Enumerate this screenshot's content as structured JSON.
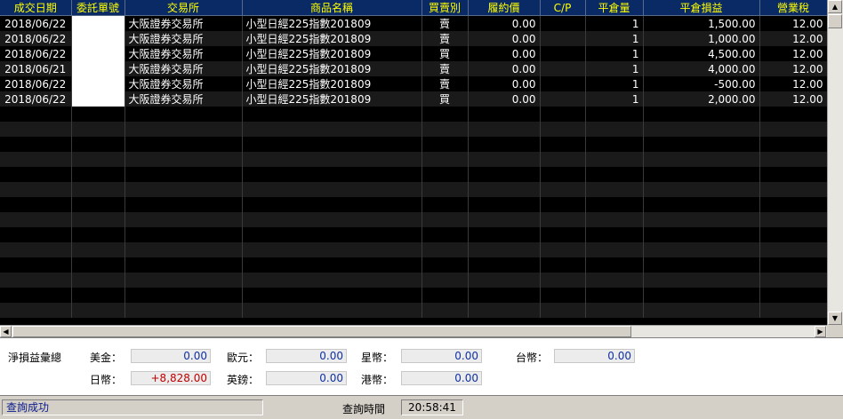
{
  "grid": {
    "columns": [
      "成交日期",
      "委託單號",
      "交易所",
      "商品名稱",
      "買賣別",
      "履約價",
      "C/P",
      "平倉量",
      "平倉損益",
      "營業稅"
    ],
    "rows": [
      {
        "date": "2018/06/22",
        "order": "",
        "exchange": "大阪證券交易所",
        "product": "小型日經225指數201809",
        "side": "賣",
        "strike": "0.00",
        "cp": "",
        "qty": "1",
        "pnl": "1,500.00",
        "tax": "12.00"
      },
      {
        "date": "2018/06/22",
        "order": "",
        "exchange": "大阪證券交易所",
        "product": "小型日經225指數201809",
        "side": "賣",
        "strike": "0.00",
        "cp": "",
        "qty": "1",
        "pnl": "1,000.00",
        "tax": "12.00"
      },
      {
        "date": "2018/06/22",
        "order": "",
        "exchange": "大阪證券交易所",
        "product": "小型日經225指數201809",
        "side": "買",
        "strike": "0.00",
        "cp": "",
        "qty": "1",
        "pnl": "4,500.00",
        "tax": "12.00"
      },
      {
        "date": "2018/06/21",
        "order": "",
        "exchange": "大阪證券交易所",
        "product": "小型日經225指數201809",
        "side": "賣",
        "strike": "0.00",
        "cp": "",
        "qty": "1",
        "pnl": "4,000.00",
        "tax": "12.00"
      },
      {
        "date": "2018/06/22",
        "order": "",
        "exchange": "大阪證券交易所",
        "product": "小型日經225指數201809",
        "side": "賣",
        "strike": "0.00",
        "cp": "",
        "qty": "1",
        "pnl": "-500.00",
        "tax": "12.00"
      },
      {
        "date": "2018/06/22",
        "order": "",
        "exchange": "大阪證券交易所",
        "product": "小型日經225指數201809",
        "side": "買",
        "strike": "0.00",
        "cp": "",
        "qty": "1",
        "pnl": "2,000.00",
        "tax": "12.00"
      }
    ]
  },
  "summary": {
    "title": "淨損益彙總",
    "usd_label": "美金：",
    "usd_value": "0.00",
    "eur_label": "歐元：",
    "eur_value": "0.00",
    "sgd_label": "星幣：",
    "sgd_value": "0.00",
    "twd_label": "台幣：",
    "twd_value": "0.00",
    "jpy_label": "日幣：",
    "jpy_value": "+8,828.00",
    "gbp_label": "英鎊：",
    "gbp_value": "0.00",
    "hkd_label": "港幣：",
    "hkd_value": "0.00"
  },
  "status": {
    "message": "查詢成功",
    "time_label": "查詢時間",
    "time_value": "20:58:41"
  },
  "colors": {
    "header_bg": "#0a2a66",
    "header_text": "#ffff00",
    "positive_jpy": "#c00000"
  },
  "icons": {
    "scroll_up": "triangle-up",
    "scroll_down": "triangle-down",
    "scroll_left": "triangle-left",
    "scroll_right": "triangle-right"
  }
}
